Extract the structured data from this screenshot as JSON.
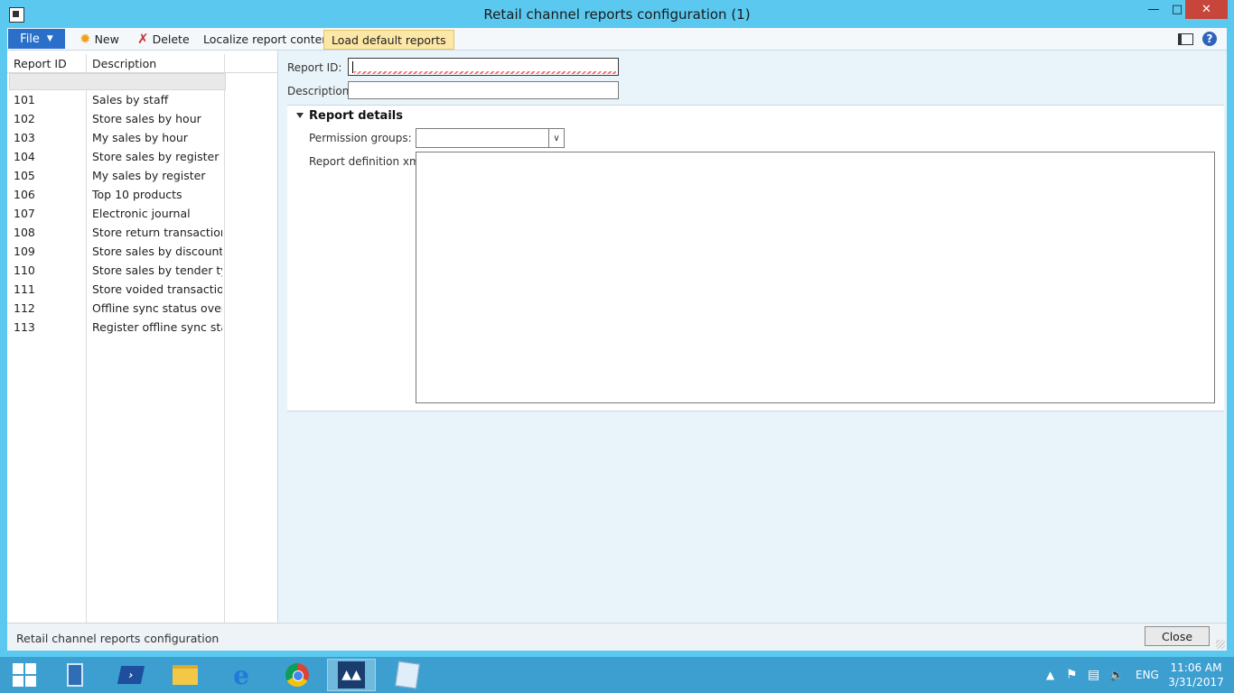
{
  "window": {
    "title": "Retail channel reports configuration (1)"
  },
  "toolbar": {
    "file_label": "File",
    "new_label": "New",
    "delete_label": "Delete",
    "localize_label": "Localize report content",
    "load_label": "Load default reports"
  },
  "grid": {
    "headers": [
      "Report ID",
      "Description"
    ],
    "rows": [
      {
        "id": "101",
        "desc": "Sales by staff"
      },
      {
        "id": "102",
        "desc": "Store sales by hour"
      },
      {
        "id": "103",
        "desc": "My sales by hour"
      },
      {
        "id": "104",
        "desc": "Store sales by register"
      },
      {
        "id": "105",
        "desc": "My sales by register"
      },
      {
        "id": "106",
        "desc": "Top 10 products"
      },
      {
        "id": "107",
        "desc": "Electronic journal"
      },
      {
        "id": "108",
        "desc": "Store return transactions"
      },
      {
        "id": "109",
        "desc": "Store sales by discount"
      },
      {
        "id": "110",
        "desc": "Store sales by tender type"
      },
      {
        "id": "111",
        "desc": "Store voided transactions"
      },
      {
        "id": "112",
        "desc": "Offline sync status overvi..."
      },
      {
        "id": "113",
        "desc": "Register offline sync status"
      }
    ]
  },
  "form": {
    "report_id_label": "Report ID:",
    "report_id_value": "",
    "description_label": "Description:",
    "description_value": "",
    "section_title": "Report details",
    "permission_label": "Permission groups:",
    "permission_value": "",
    "xml_label": "Report definition xml:",
    "xml_value": ""
  },
  "status": {
    "text": "Retail channel reports configuration",
    "close_label": "Close"
  },
  "taskbar": {
    "language": "ENG",
    "time": "11:06 AM",
    "date": "3/31/2017"
  },
  "colors": {
    "accent": "#2a6fc9",
    "titlebar": "#5bc9ef",
    "highlight": "#fde7a6",
    "close": "#c7453a"
  }
}
